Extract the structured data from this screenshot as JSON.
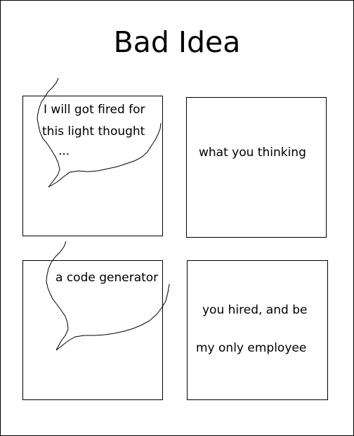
{
  "title": "Bad Idea",
  "panels": [
    {
      "lines": [
        "I will got fired for",
        "this light thought",
        "..."
      ]
    },
    {
      "lines": [
        "what you thinking"
      ]
    },
    {
      "lines": [
        "a code generator"
      ]
    },
    {
      "lines": [
        "you hired, and be",
        "my only employee"
      ]
    }
  ]
}
